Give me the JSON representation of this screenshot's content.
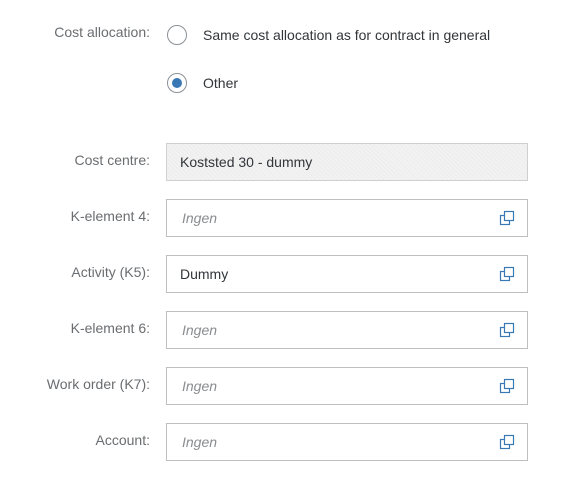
{
  "cost_allocation": {
    "label": "Cost allocation:",
    "options": [
      {
        "label": "Same cost allocation as for contract in general",
        "selected": false
      },
      {
        "label": "Other",
        "selected": true
      }
    ]
  },
  "fields": {
    "cost_centre": {
      "label": "Cost centre:",
      "value": "Koststed 30 - dummy"
    },
    "k_element_4": {
      "label": "K-element 4:",
      "placeholder": "Ingen"
    },
    "activity_k5": {
      "label": "Activity (K5):",
      "value": "Dummy"
    },
    "k_element_6": {
      "label": "K-element 6:",
      "placeholder": "Ingen"
    },
    "work_order_k7": {
      "label": "Work order (K7):",
      "placeholder": "Ingen"
    },
    "account": {
      "label": "Account:",
      "placeholder": "Ingen"
    }
  },
  "icons": {
    "value_help": "value-help-icon"
  },
  "colors": {
    "radio_selected": "#3a78b5",
    "label": "#6a6d70",
    "placeholder": "#8a8d91"
  }
}
